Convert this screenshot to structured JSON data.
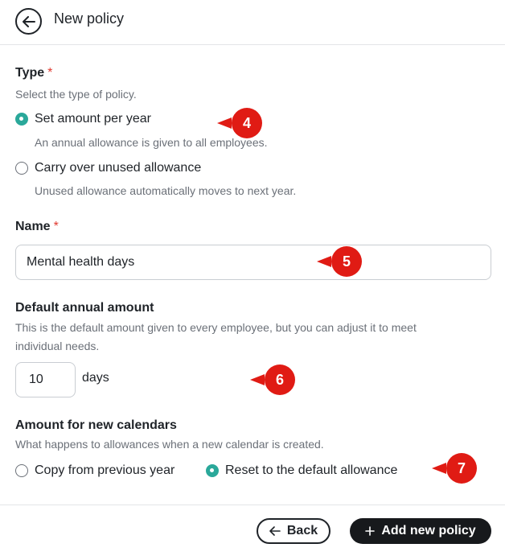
{
  "header": {
    "title": "New policy",
    "back_icon": "arrow-left-circle-icon"
  },
  "type_section": {
    "label": "Type",
    "required_mark": "*",
    "help": "Select the type of policy.",
    "options": [
      {
        "label": "Set amount per year",
        "help": "An annual allowance is given to all employees.",
        "checked": true
      },
      {
        "label": "Carry over unused allowance",
        "help": "Unused allowance automatically moves to next year.",
        "checked": false
      }
    ]
  },
  "name_section": {
    "label": "Name",
    "required_mark": "*",
    "value": "Mental health days"
  },
  "amount_section": {
    "label": "Default annual amount",
    "help_line1": "This is the default amount given to every employee, but you can adjust it to meet",
    "help_line2": "individual needs.",
    "value": "10",
    "unit": "days"
  },
  "calendars_section": {
    "label": "Amount for new calendars",
    "help": "What happens to allowances when a new calendar is created.",
    "options": [
      {
        "label": "Copy from previous year",
        "checked": false
      },
      {
        "label": "Reset to the default allowance",
        "checked": true
      }
    ]
  },
  "markers": [
    "4",
    "5",
    "6",
    "7"
  ],
  "footer": {
    "back_label": "Back",
    "add_label": "Add new policy"
  },
  "colors": {
    "accent": "#2aa89a",
    "required": "#e0392f",
    "marker": "#e01b14",
    "primary_button": "#17191c"
  }
}
